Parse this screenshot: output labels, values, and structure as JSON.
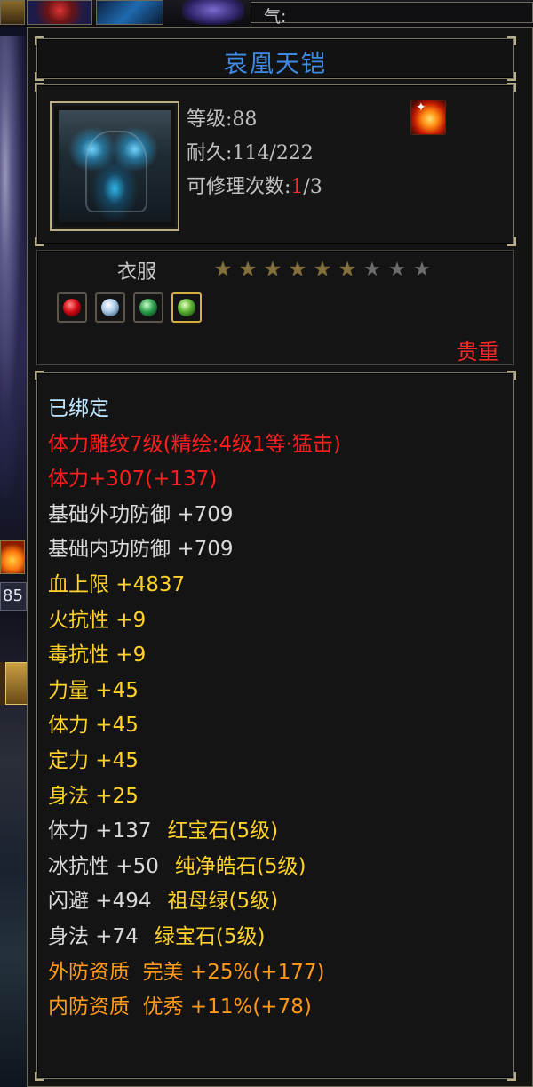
{
  "hud": {
    "qi_label": "气:",
    "side_number": "85"
  },
  "tooltip": {
    "item_name": "哀凰天铠",
    "level_label": "等级:88",
    "durability_label": "耐久:114/222",
    "repair_prefix": "可修理次数:",
    "repair_current": "1",
    "repair_suffix": "/3",
    "type": "衣服",
    "stars": {
      "lit": 6,
      "total": 9
    },
    "gems": [
      "red-gem",
      "white-gem",
      "green-gem",
      "lime-gem"
    ],
    "rarity": "贵重",
    "attributes": [
      {
        "text": "已绑定",
        "color": "cyan"
      },
      {
        "text": "体力雕纹7级(精绘:4级1等·猛击)",
        "color": "red"
      },
      {
        "text": "体力+307(+137)",
        "color": "red"
      },
      {
        "text": "基础外功防御 +709",
        "color": "white"
      },
      {
        "text": "基础内功防御 +709",
        "color": "white"
      },
      {
        "text": "血上限 +4837",
        "color": "yellow"
      },
      {
        "text": "火抗性 +9",
        "color": "yellow"
      },
      {
        "text": "毒抗性 +9",
        "color": "yellow"
      },
      {
        "text": "力量 +45",
        "color": "yellow"
      },
      {
        "text": "体力 +45",
        "color": "yellow"
      },
      {
        "text": "定力 +45",
        "color": "yellow"
      },
      {
        "text": "身法 +25",
        "color": "yellow"
      }
    ],
    "gem_attributes": [
      {
        "stat": "体力 +137",
        "gem": "红宝石(5级)"
      },
      {
        "stat": "冰抗性 +50",
        "gem": "纯净皓石(5级)"
      },
      {
        "stat": "闪避 +494",
        "gem": "祖母绿(5级)"
      },
      {
        "stat": "身法 +74",
        "gem": "绿宝石(5级)"
      }
    ],
    "qualities": [
      {
        "text": "外防资质  完美 +25%(+177)"
      },
      {
        "text": "内防资质  优秀 +11%(+78)"
      }
    ]
  },
  "colors": {
    "title": "#3d8be6",
    "red": "#ff1f1f",
    "yellow": "#ffd22a",
    "orange": "#ff9a1a",
    "cyan": "#bfe6ff",
    "white": "#dadada"
  }
}
